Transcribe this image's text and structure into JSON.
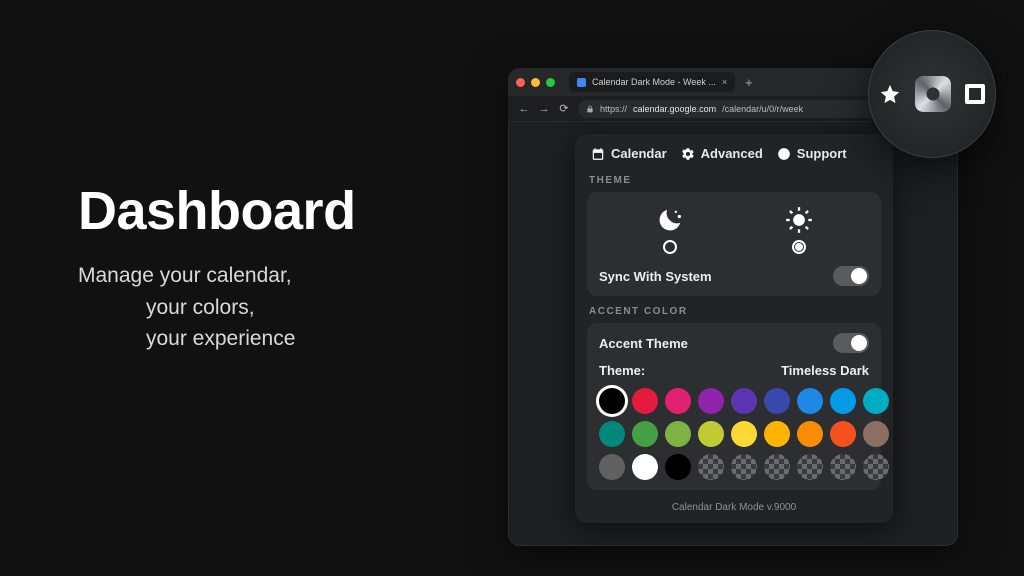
{
  "hero": {
    "title": "Dashboard",
    "line1": "Manage your calendar,",
    "line2": "your colors,",
    "line3": "your experience"
  },
  "browser": {
    "tab_title": "Calendar Dark Mode - Week ...",
    "url_prefix": "https://",
    "url_domain": "calendar.google.com",
    "url_path": "/calendar/u/0/r/week"
  },
  "tabs": {
    "calendar": "Calendar",
    "advanced": "Advanced",
    "support": "Support"
  },
  "sections": {
    "theme": "THEME",
    "accent": "ACCENT COLOR"
  },
  "labels": {
    "sync": "Sync With System",
    "accent_theme": "Accent Theme",
    "theme_key": "Theme:",
    "theme_value": "Timeless Dark"
  },
  "state": {
    "theme_selected": "light",
    "sync_on": true,
    "accent_on": true,
    "selected_swatch": 0
  },
  "swatches": {
    "row1": [
      "#000000",
      "#e41b3f",
      "#e0216f",
      "#8e24aa",
      "#5e35b1",
      "#3949ab",
      "#1e88e5",
      "#039be5",
      "#00acc1"
    ],
    "row2": [
      "#00897b",
      "#43a047",
      "#7cb342",
      "#c0ca33",
      "#fdd835",
      "#ffb300",
      "#fb8c00",
      "#f4511e",
      "#8d6e63"
    ],
    "row3_solids": [
      "#616161",
      "#ffffff",
      "#000000"
    ],
    "row3_checkers": 6
  },
  "version": "Calendar Dark Mode v.9000"
}
